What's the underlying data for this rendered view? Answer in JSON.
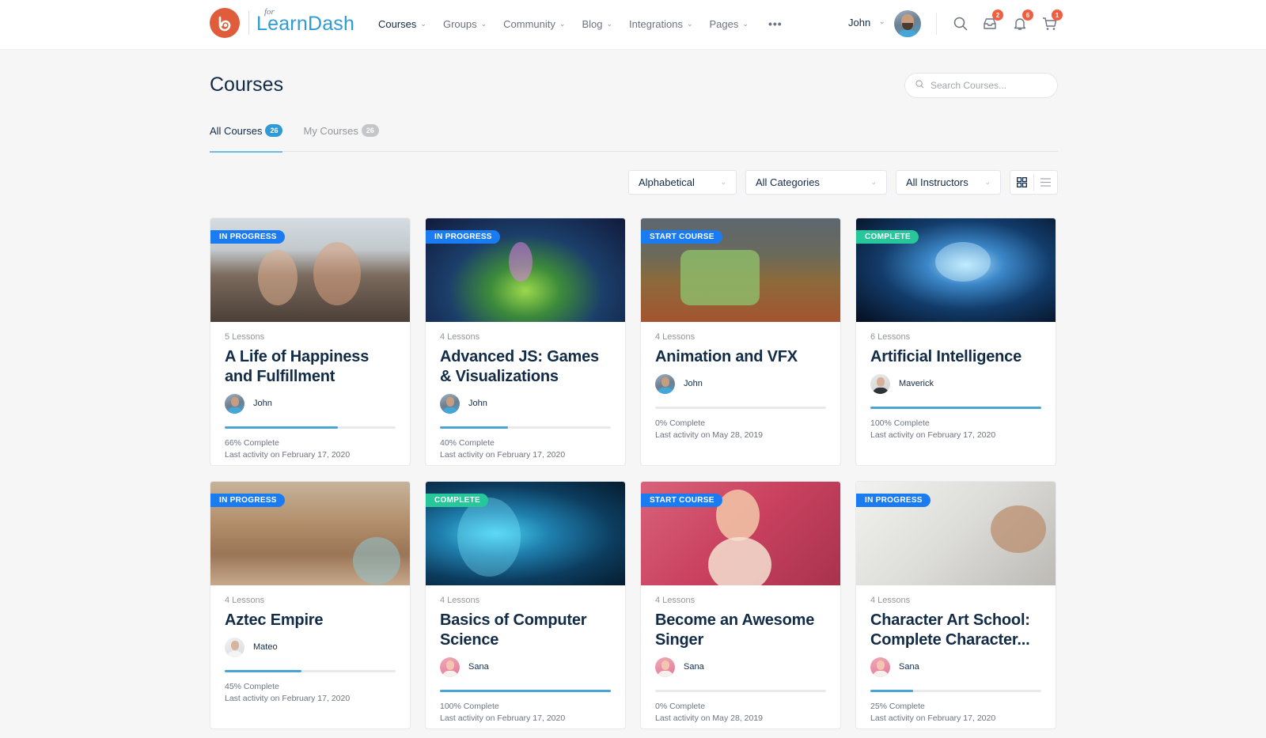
{
  "header": {
    "logo_for": "for",
    "logo_text": "LearnDash",
    "logo_icon": "buddyboss-logo-icon",
    "nav": [
      {
        "label": "Courses",
        "active": true
      },
      {
        "label": "Groups",
        "active": false
      },
      {
        "label": "Community",
        "active": false
      },
      {
        "label": "Blog",
        "active": false
      },
      {
        "label": "Integrations",
        "active": false
      },
      {
        "label": "Pages",
        "active": false
      }
    ],
    "more_label": "•••",
    "user_name": "John",
    "icons": {
      "search": "search-icon",
      "messages": "inbox-icon",
      "notifications": "bell-icon",
      "cart": "cart-icon"
    },
    "badges": {
      "messages": "2",
      "notifications": "6",
      "cart": "1"
    }
  },
  "page": {
    "title": "Courses",
    "search_placeholder": "Search Courses..."
  },
  "tabs": [
    {
      "label": "All Courses",
      "count": "26",
      "active": true
    },
    {
      "label": "My Courses",
      "count": "26",
      "active": false
    }
  ],
  "filters": {
    "order": "Alphabetical",
    "category": "All Categories",
    "instructor": "All Instructors",
    "view": "grid"
  },
  "colors": {
    "accent": "#2f9bd6",
    "in_progress": "#1b7cf2",
    "start_course": "#1b7cf2",
    "complete": "#27c69b",
    "badge": "#ef5f40",
    "progress": "#4aa5d7"
  },
  "courses": [
    {
      "status": "IN PROGRESS",
      "status_type": "in_progress",
      "lessons": "5 Lessons",
      "title": "A Life of Happiness and Fulfillment",
      "author": "John",
      "progress": 66,
      "progress_label": "66% Complete",
      "activity": "Last activity on February 17, 2020"
    },
    {
      "status": "IN PROGRESS",
      "status_type": "in_progress",
      "lessons": "4 Lessons",
      "title": "Advanced JS: Games & Visualizations",
      "author": "John",
      "progress": 40,
      "progress_label": "40% Complete",
      "activity": "Last activity on February 17, 2020"
    },
    {
      "status": "START COURSE",
      "status_type": "start_course",
      "lessons": "4 Lessons",
      "title": "Animation and VFX",
      "author": "John",
      "progress": 0,
      "progress_label": "0% Complete",
      "activity": "Last activity on May 28, 2019"
    },
    {
      "status": "COMPLETE",
      "status_type": "complete",
      "lessons": "6 Lessons",
      "title": "Artificial Intelligence",
      "author": "Maverick",
      "progress": 100,
      "progress_label": "100% Complete",
      "activity": "Last activity on February 17, 2020"
    },
    {
      "status": "IN PROGRESS",
      "status_type": "in_progress",
      "lessons": "4 Lessons",
      "title": "Aztec Empire",
      "author": "Mateo",
      "progress": 45,
      "progress_label": "45% Complete",
      "activity": "Last activity on February 17, 2020"
    },
    {
      "status": "COMPLETE",
      "status_type": "complete",
      "lessons": "4 Lessons",
      "title": "Basics of Computer Science",
      "author": "Sana",
      "progress": 100,
      "progress_label": "100% Complete",
      "activity": "Last activity on February 17, 2020"
    },
    {
      "status": "START COURSE",
      "status_type": "start_course",
      "lessons": "4 Lessons",
      "title": "Become an Awesome Singer",
      "author": "Sana",
      "progress": 0,
      "progress_label": "0% Complete",
      "activity": "Last activity on May 28, 2019"
    },
    {
      "status": "IN PROGRESS",
      "status_type": "in_progress",
      "lessons": "4 Lessons",
      "title": "Character Art School: Complete Character...",
      "author": "Sana",
      "progress": 25,
      "progress_label": "25% Complete",
      "activity": "Last activity on February 17, 2020"
    }
  ]
}
